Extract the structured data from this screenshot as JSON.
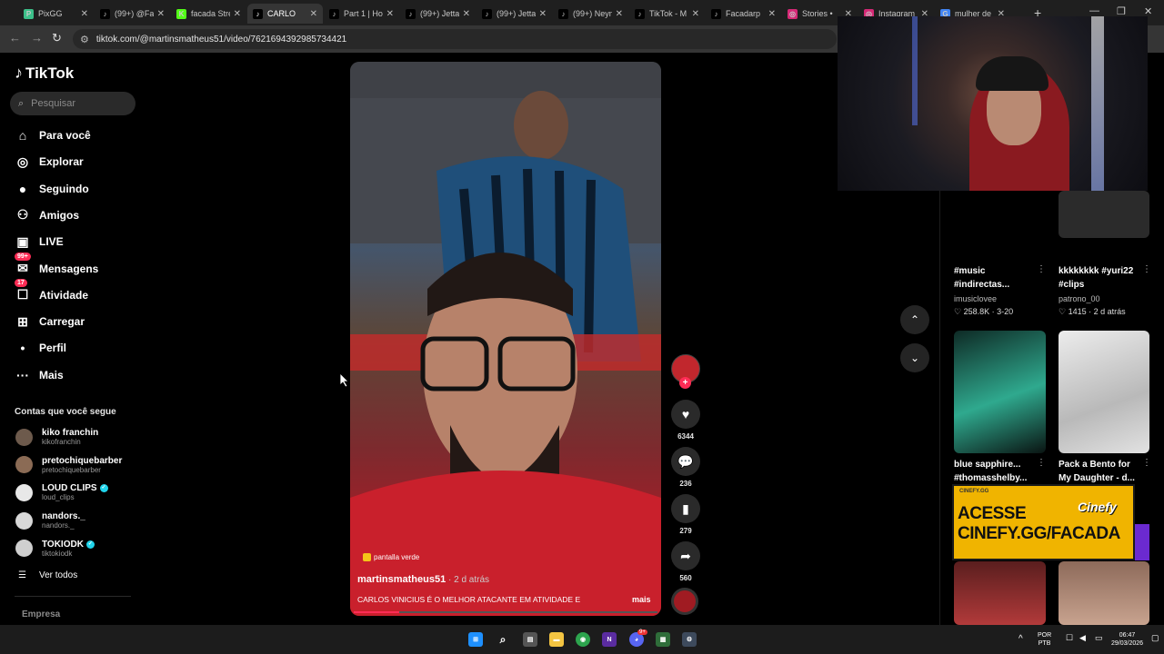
{
  "browser": {
    "tabs": [
      {
        "label": "PixGG",
        "fav_color": "#3cc08a",
        "fav_glyph": "P"
      },
      {
        "label": "(99+) @Fa",
        "fav_color": "#000000",
        "fav_glyph": "♪"
      },
      {
        "label": "facada Stre",
        "fav_color": "#53fc18",
        "fav_glyph": "K"
      },
      {
        "label": "CARLO",
        "fav_color": "#000000",
        "fav_glyph": "♪",
        "active": true
      },
      {
        "label": "Part 1 | Ho",
        "fav_color": "#000000",
        "fav_glyph": "♪"
      },
      {
        "label": "(99+) Jetta",
        "fav_color": "#000000",
        "fav_glyph": "♪"
      },
      {
        "label": "(99+) Jetta",
        "fav_color": "#000000",
        "fav_glyph": "♪"
      },
      {
        "label": "(99+) Neym",
        "fav_color": "#000000",
        "fav_glyph": "♪"
      },
      {
        "label": "TikTok - M",
        "fav_color": "#000000",
        "fav_glyph": "♪"
      },
      {
        "label": "Facadarp",
        "fav_color": "#000000",
        "fav_glyph": "♪"
      },
      {
        "label": "Stories •",
        "fav_color": "#d62976",
        "fav_glyph": "◎"
      },
      {
        "label": "Instagram",
        "fav_color": "#d62976",
        "fav_glyph": "◎"
      },
      {
        "label": "mulher de",
        "fav_color": "#4285f4",
        "fav_glyph": "G"
      }
    ],
    "url": "tiktok.com/@martinsmatheus51/video/7621694392985734421"
  },
  "sidebar": {
    "logo": "TikTok",
    "search_placeholder": "Pesquisar",
    "nav": [
      {
        "label": "Para você",
        "icon": "home-icon",
        "glyph": "⌂"
      },
      {
        "label": "Explorar",
        "icon": "compass-icon",
        "glyph": "◎"
      },
      {
        "label": "Seguindo",
        "icon": "following-icon",
        "glyph": "●"
      },
      {
        "label": "Amigos",
        "icon": "friends-icon",
        "glyph": "⚇"
      },
      {
        "label": "LIVE",
        "icon": "live-icon",
        "glyph": "▣"
      },
      {
        "label": "Mensagens",
        "icon": "messages-icon",
        "glyph": "✉",
        "badge": "99+"
      },
      {
        "label": "Atividade",
        "icon": "activity-icon",
        "glyph": "☐",
        "badge": "17"
      },
      {
        "label": "Carregar",
        "icon": "upload-icon",
        "glyph": "⊞"
      },
      {
        "label": "Perfil",
        "icon": "profile-icon",
        "glyph": "•"
      },
      {
        "label": "Mais",
        "icon": "more-icon",
        "glyph": "···"
      }
    ],
    "following_title": "Contas que você segue",
    "accounts": [
      {
        "name": "kiko franchin",
        "handle": "kikofranchin",
        "verified": false
      },
      {
        "name": "pretochiquebarber",
        "handle": "pretochiquebarber",
        "verified": false
      },
      {
        "name": "LOUD CLIPS",
        "handle": "loud_clips",
        "verified": true
      },
      {
        "name": "nandors._",
        "handle": "nandors._",
        "verified": false
      },
      {
        "name": "TOKIODK",
        "handle": "tiktokiodk",
        "verified": true
      }
    ],
    "see_all": "Ver todos",
    "company": "Empresa"
  },
  "video": {
    "tag": "pantalla verde",
    "author": "martinsmatheus51",
    "ago": " · 2 d atrás",
    "caption": "CARLOS VINICIUS É O MELHOR ATACANTE EM ATIVIDADE E",
    "more": "mais",
    "progress": 0.15,
    "likes": "6344",
    "comments": "236",
    "saves": "279",
    "shares": "560"
  },
  "recommendations": [
    {
      "title": "#music #indirectas...",
      "author": "imusiclovee",
      "likes": "258.8K",
      "date": "3-20"
    },
    {
      "title": "kkkkkkkk #yuri22 #clips",
      "author": "patrono_00",
      "likes": "1415",
      "date": "2 d atrás"
    },
    {
      "title": "blue sapphire... #thomasshelby...",
      "author": "",
      "likes": "",
      "date": ""
    },
    {
      "title": "Pack a Bento for My Daughter - d...",
      "author": "",
      "likes": "",
      "date": ""
    }
  ],
  "ad": {
    "small": "CINEFY.GG",
    "line1": "ACESSE",
    "line2": "CINEFY.GG/FACADA",
    "logo": "Cinefy"
  },
  "taskbar": {
    "lang_top": "POR",
    "lang_bottom": "PTB",
    "time": "06:47",
    "date": "29/03/2026",
    "discord_badge": "9+"
  }
}
